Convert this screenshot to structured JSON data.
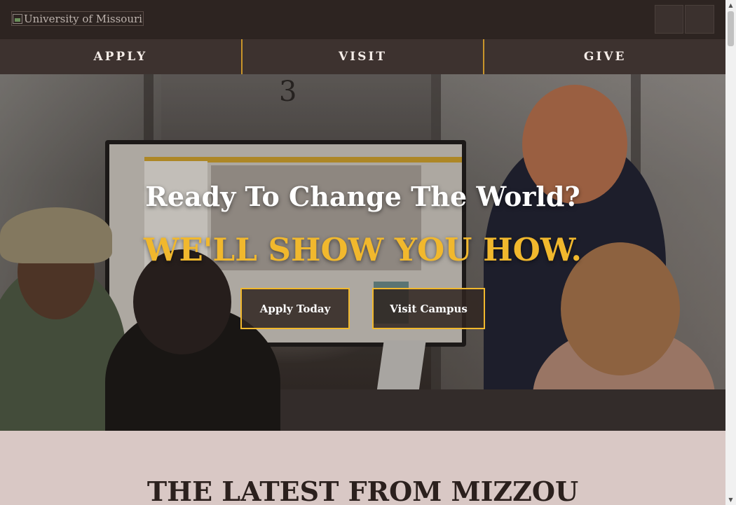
{
  "header": {
    "logo_alt": "University of Missouri",
    "icons": [
      "broken-image-icon",
      "search-icon",
      "menu-icon"
    ]
  },
  "nav": {
    "items": [
      {
        "label": "APPLY"
      },
      {
        "label": "VISIT"
      },
      {
        "label": "GIVE"
      }
    ]
  },
  "hero": {
    "title": "Ready To Change The World?",
    "subtitle": "WE'LL SHOW YOU HOW.",
    "apply_button": "Apply Today",
    "visit_button": "Visit Campus"
  },
  "latest": {
    "title": "THE LATEST FROM MIZZOU"
  },
  "colors": {
    "brand_gold": "#f1b82d",
    "dark_brown": "#2d2421",
    "nav_bg": "#3d322f",
    "section_bg": "#d9c8c5"
  }
}
